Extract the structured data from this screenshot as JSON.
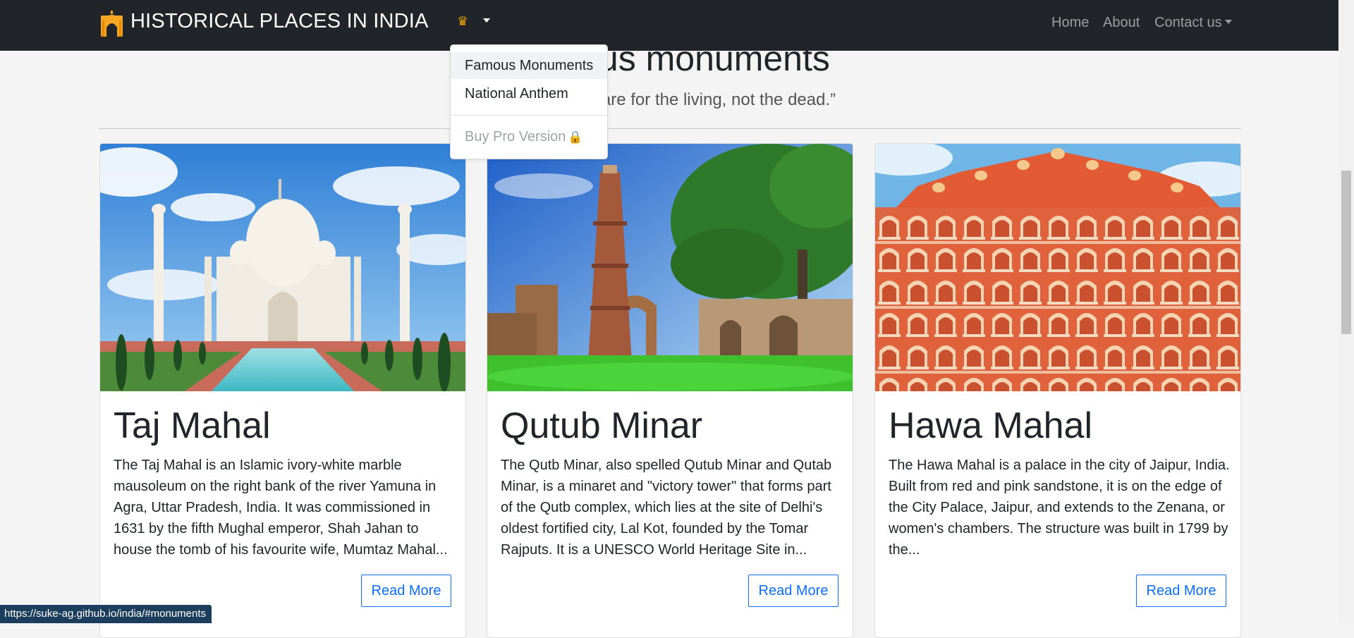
{
  "navbar": {
    "brand": "HISTORICAL PLACES IN INDIA",
    "crown_glyph": "♛",
    "links": {
      "home": "Home",
      "about": "About",
      "contact": "Contact us"
    }
  },
  "section": {
    "heading": "Famous monuments",
    "quote": "“Monuments are for the living, not the dead.”"
  },
  "dropdown": {
    "items": [
      "Famous Monuments",
      "National Anthem"
    ],
    "pro": "Buy Pro Version",
    "lock_glyph": "🔒"
  },
  "cards": [
    {
      "title": "Taj Mahal",
      "text": "The Taj Mahal is an Islamic ivory-white marble mausoleum on the right bank of the river Yamuna in Agra, Uttar Pradesh, India. It was commissioned in 1631 by the fifth Mughal emperor, Shah Jahan to house the tomb of his favourite wife, Mumtaz Mahal...",
      "button": "Read More"
    },
    {
      "title": "Qutub Minar",
      "text": "The Qutb Minar, also spelled Qutub Minar and Qutab Minar, is a minaret and \"victory tower\" that forms part of the Qutb complex, which lies at the site of Delhi's oldest fortified city, Lal Kot, founded by the Tomar Rajputs. It is a UNESCO World Heritage Site in...",
      "button": "Read More"
    },
    {
      "title": "Hawa Mahal",
      "text": "The Hawa Mahal is a palace in the city of Jaipur, India. Built from red and pink sandstone, it is on the edge of the City Palace, Jaipur, and extends to the Zenana, or women's chambers. The structure was built in 1799 by the...",
      "button": "Read More"
    }
  ],
  "status_url": "https://suke-ag.github.io/india/#monuments",
  "colors": {
    "navbar": "#212529",
    "accent": "#0d6efd",
    "crown": "#f0a500"
  }
}
